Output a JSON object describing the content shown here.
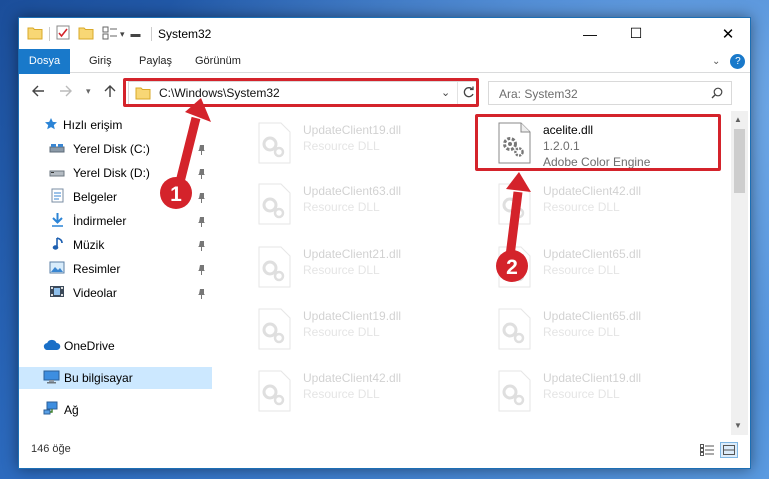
{
  "window": {
    "title": "System32",
    "controls": {
      "minimize": "—",
      "maximize": "☐",
      "close": "✕"
    }
  },
  "ribbon": {
    "tabs": [
      "Dosya",
      "Giriş",
      "Paylaş",
      "Görünüm"
    ],
    "help": "?"
  },
  "address": {
    "path": "C:\\Windows\\System32",
    "search_placeholder": "Ara: System32"
  },
  "sidebar": {
    "items": [
      {
        "label": "Hızlı erişim",
        "icon": "star-icon",
        "pinned": false
      },
      {
        "label": "Yerel Disk (C:)",
        "icon": "drive-icon",
        "pinned": true
      },
      {
        "label": "Yerel Disk (D:)",
        "icon": "drive-icon",
        "pinned": true
      },
      {
        "label": "Belgeler",
        "icon": "documents-icon",
        "pinned": true
      },
      {
        "label": "İndirmeler",
        "icon": "download-icon",
        "pinned": true
      },
      {
        "label": "Müzik",
        "icon": "music-icon",
        "pinned": true
      },
      {
        "label": "Resimler",
        "icon": "pictures-icon",
        "pinned": true
      },
      {
        "label": "Videolar",
        "icon": "videos-icon",
        "pinned": true
      },
      {
        "label": "OneDrive",
        "icon": "cloud-icon",
        "pinned": false
      },
      {
        "label": "Bu bilgisayar",
        "icon": "computer-icon",
        "pinned": false,
        "selected": true
      },
      {
        "label": "Ağ",
        "icon": "network-icon",
        "pinned": false
      }
    ]
  },
  "files": {
    "left_column": [
      {
        "name": "UpdateClient19.dll",
        "desc": "Resource DLL"
      },
      {
        "name": "UpdateClient63.dll",
        "desc": "Resource DLL"
      },
      {
        "name": "UpdateClient21.dll",
        "desc": "Resource DLL"
      },
      {
        "name": "UpdateClient19.dll",
        "desc": "Resource DLL"
      },
      {
        "name": "UpdateClient42.dll",
        "desc": "Resource DLL"
      }
    ],
    "right_column": [
      {
        "name": "acelite.dll",
        "version": "1.2.0.1",
        "desc": "Adobe Color Engine",
        "highlighted": true
      },
      {
        "name": "UpdateClient42.dll",
        "desc": "Resource DLL"
      },
      {
        "name": "UpdateClient65.dll",
        "desc": "Resource DLL"
      },
      {
        "name": "UpdateClient65.dll",
        "desc": "Resource DLL"
      },
      {
        "name": "UpdateClient19.dll",
        "desc": "Resource DLL"
      }
    ]
  },
  "status": {
    "item_count": "146 öğe"
  },
  "annotations": {
    "step1": "1",
    "step2": "2",
    "color": "#d4232b"
  }
}
